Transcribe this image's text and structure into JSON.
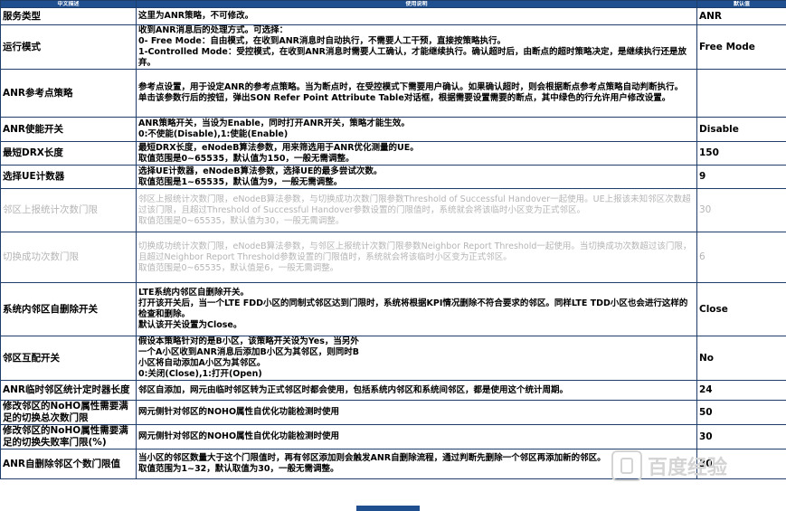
{
  "header": {
    "col1": "中文描述",
    "col2": "使用说明",
    "col3": "默认值"
  },
  "rows": [
    {
      "name": "服务类型",
      "desc": [
        "这里为ANR策略，不可修改。"
      ],
      "default": "ANR",
      "faded": false
    },
    {
      "name": "运行模式",
      "desc": [
        "收到ANR消息后的处理方式。可选择：",
        "0- Free Mode：自由模式，在收到ANR消息时自动执行，不需要人工干预，直接按策略执行。",
        "1-Controlled Mode：受控模式，在收到ANR消息时需要人工确认，才能继续执行。确认超时后，由断点的超时策略决定，是继续执行还是放弃。"
      ],
      "default": "Free Mode",
      "faded": false
    },
    {
      "name": "ANR参考点策略",
      "desc": [
        "参考点设置，用于设定ANR的参考点策略。当为断点时，在受控模式下需要用户确认。如果确认超时，则会根据断点参考点策略自动判断执行。",
        "单击该参数行后的按钮，弹出SON Refer Point Attribute Table对话框，根据需要设置需要的断点，其中绿色的行允许用户修改设置。"
      ],
      "default": "",
      "faded": false
    },
    {
      "name": "ANR使能开关",
      "desc": [
        "ANR策略开关，当设为Enable，同时打开ANR开关，策略才能生效。",
        "0:不使能(Disable),1:使能(Enable)"
      ],
      "default": "Disable",
      "faded": false
    },
    {
      "name": "最短DRX长度",
      "desc": [
        "最短DRX长度，eNodeB算法参数，用来筛选用于ANR优化测量的UE。",
        "取值范围是0~65535，默认值为150，一般无需调整。"
      ],
      "default": "150",
      "faded": false
    },
    {
      "name": "选择UE计数器",
      "desc": [
        "选择UE计数器，eNodeB算法参数，选择UE的最多尝试次数。",
        "取值范围是1~65535，默认值为9，一般无需调整。"
      ],
      "default": "9",
      "faded": false
    },
    {
      "name": "邻区上报统计次数门限",
      "desc": [
        "邻区上报统计次数门限，eNodeB算法参数，与切换成功次数门限参数Threshold of Successful Handover一起使用。UE上报该未知邻区次数超过该门限，且超过Threshold of Successful Handover参数设置的门限值时，系统就会将该临时小区变为正式邻区。",
        "取值范围是0~65535，默认值为30，一般无需调整。"
      ],
      "default": "30",
      "faded": true
    },
    {
      "name": "切换成功次数门限",
      "desc": [
        "切换成功统计次数门限，eNodeB算法参数，与邻区上报统计次数门限参数Neighbor Report Threshold一起使用。当切换成功次数超过该门限，且超过Neighbor Report Threshold参数设置的门限值时，系统就会将该临时小区变为正式邻区。",
        "取值范围是0~65535，默认值是6，一般无需调整。"
      ],
      "default": "6",
      "faded": true
    },
    {
      "name": "系统内邻区自删除开关",
      "desc": [
        "LTE系统内邻区自删除开关。",
        "打开该开关后，当一个LTE FDD小区的同制式邻区达到门限时，系统将根据KPI情况删除不符合要求的邻区。同样LTE TDD小区也会进行这样的检查和删除。",
        "默认该开关设置为Close。"
      ],
      "default": "Close",
      "faded": false
    },
    {
      "name": "邻区互配开关",
      "desc": [
        "假设本策略针对的是B小区，该策略开关设为Yes，当另外",
        "一个A小区收到ANR消息后添加B小区为其邻区，则同时B",
        "小区将自动添加A小区为其邻区。",
        "0:关闭(Close),1:打开(Open)"
      ],
      "default": "No",
      "faded": false
    },
    {
      "name": "ANR临时邻区统计定时器长度",
      "desc": [
        "邻区自添加，网元由临时邻区转为正式邻区时都会使用，包括系统内邻区和系统间邻区，都是使用这个统计周期。"
      ],
      "default": "24",
      "faded": false
    },
    {
      "name": "修改邻区的NoHO属性需要满足的切换总次数门限",
      "desc": [
        "网元侧针对邻区的NOHO属性自优化功能检测时使用"
      ],
      "default": "50",
      "faded": false
    },
    {
      "name": "修改邻区的NoHO属性需要满足的切换失败率门限(%)",
      "desc": [
        "网元侧针对邻区的NOHO属性自优化功能检测时使用"
      ],
      "default": "30",
      "faded": false
    },
    {
      "name": "ANR自删除邻区个数门限值",
      "desc": [
        "当小区的邻区数量大于这个门限值时，再有邻区添加则会触发ANR自删除流程，通过判断先删除一个邻区再添加新的邻区。",
        "取值范围为1~32，默认取值为30，一般无需调整。"
      ],
      "default": "30",
      "faded": false
    }
  ],
  "watermark": {
    "text": "百度经验"
  }
}
